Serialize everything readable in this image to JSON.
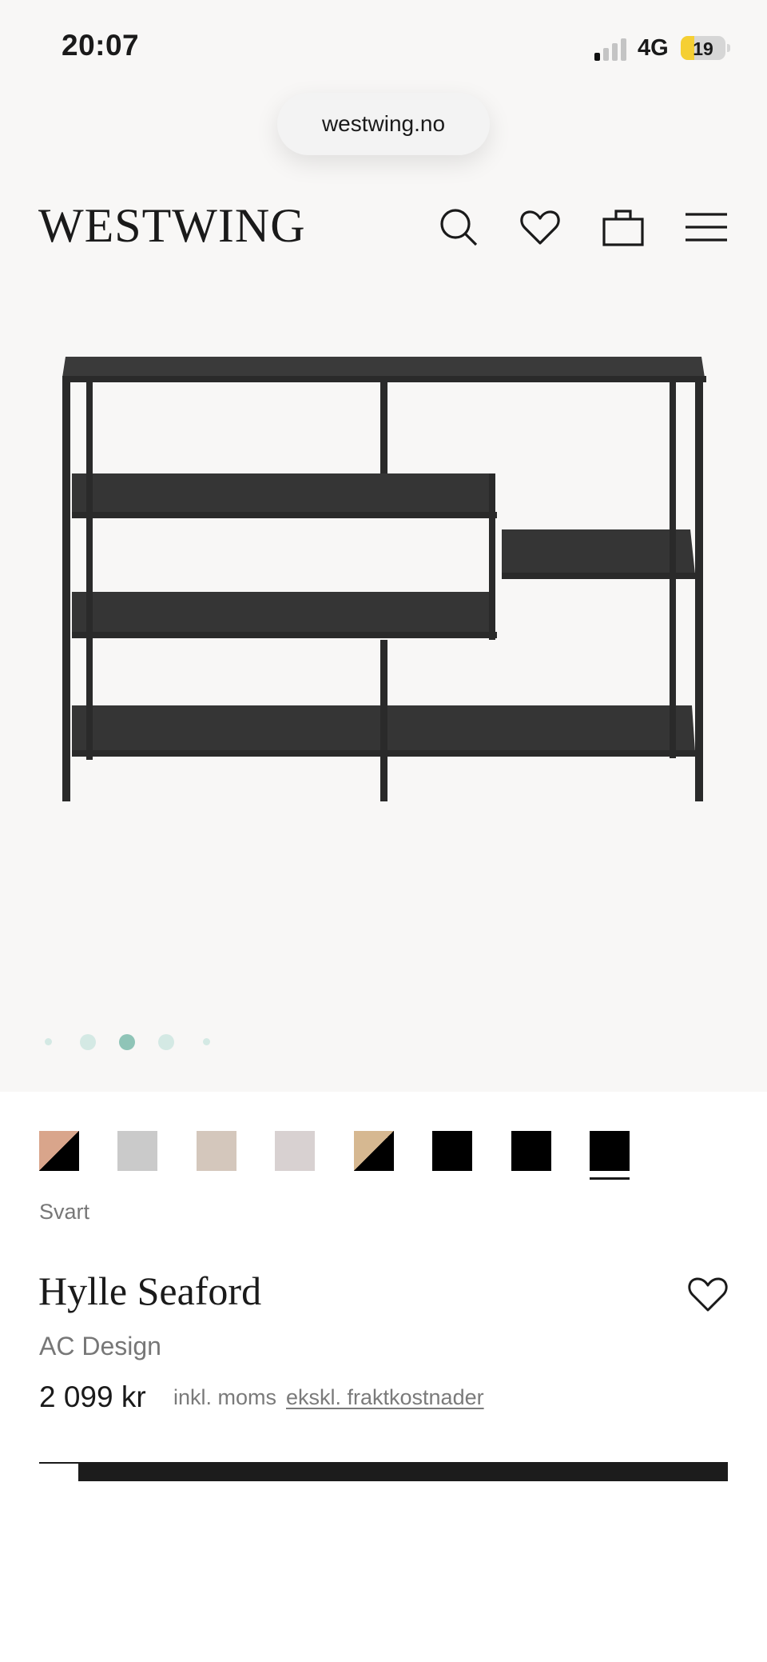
{
  "status": {
    "time": "20:07",
    "network": "4G",
    "battery": "19"
  },
  "browser": {
    "url": "westwing.no"
  },
  "header": {
    "logo": "WESTWING",
    "icons": [
      "search-icon",
      "heart-icon",
      "bag-icon",
      "menu-icon"
    ]
  },
  "gallery": {
    "slides": 5,
    "active": 3
  },
  "variants": {
    "swatches": [
      {
        "colors": [
          "#d9a58b",
          "#000000"
        ],
        "diagonal": true
      },
      {
        "colors": [
          "#cacaca"
        ]
      },
      {
        "colors": [
          "#d4c7bc"
        ]
      },
      {
        "colors": [
          "#d8d1d1"
        ]
      },
      {
        "colors": [
          "#d6b891",
          "#000000"
        ],
        "diagonal": true
      },
      {
        "colors": [
          "#000000"
        ]
      },
      {
        "colors": [
          "#000000"
        ]
      },
      {
        "colors": [
          "#000000"
        ],
        "selected": true
      }
    ],
    "selected_name": "Svart"
  },
  "product": {
    "title": "Hylle Seaford",
    "brand": "AC Design",
    "price": "2 099 kr",
    "tax_note": "inkl. moms",
    "shipping_link": "ekskl. fraktkostnader"
  },
  "theme": {
    "accent": "#8fc4b7",
    "dot_light": "#d4e9e4",
    "text": "#1a1a1a",
    "muted": "#777777"
  }
}
